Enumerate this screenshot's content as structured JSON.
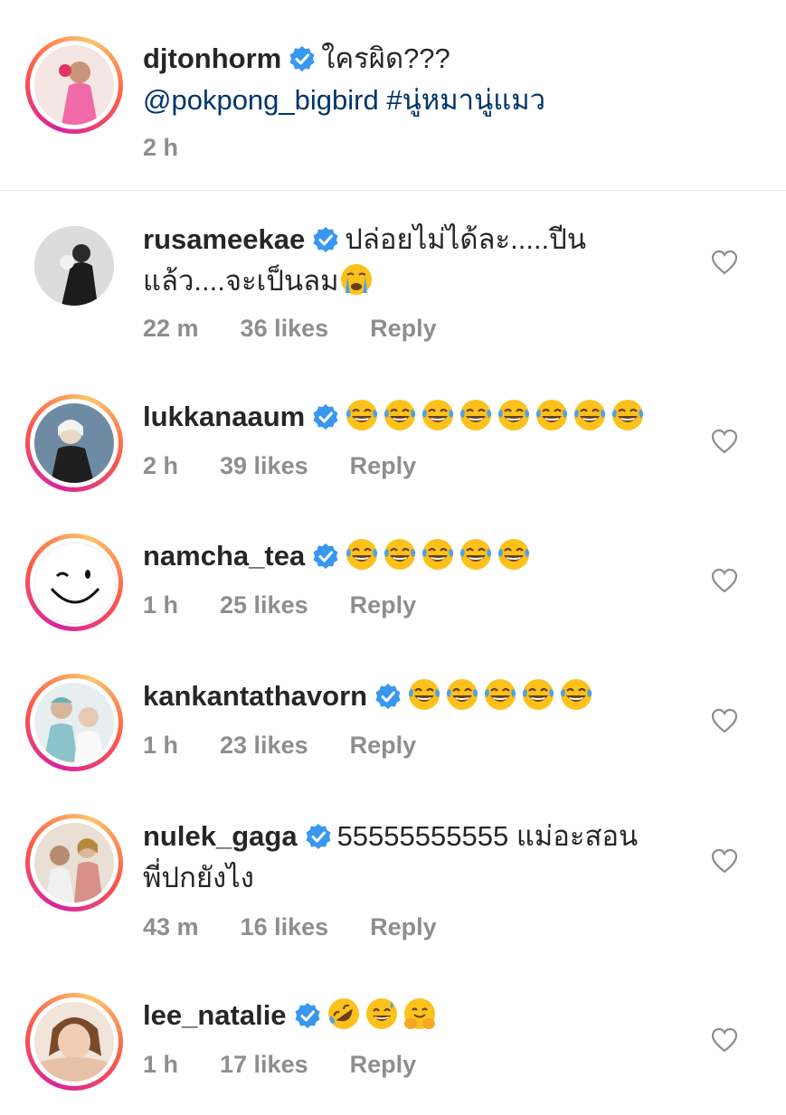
{
  "caption": {
    "username": "djtonhorm",
    "text": "ใครผิด???",
    "mention": "@pokpong_bigbird #นู่หมานู่แมว",
    "time": "2 h"
  },
  "comments": [
    {
      "username": "rusameekae",
      "text": "ปล่อยไม่ได้ละ.....ปีน",
      "text2": "แล้ว....จะเป็นลม",
      "emojis": [
        "crying-face"
      ],
      "time": "22 m",
      "likes": "36 likes",
      "reply": "Reply"
    },
    {
      "username": "lukkanaaum",
      "text": "",
      "emojis": [
        "laughing-tears",
        "laughing-tears",
        "laughing-tears",
        "laughing-tears",
        "laughing-tears",
        "laughing-tears",
        "laughing-tears",
        "laughing-tears"
      ],
      "time": "2 h",
      "likes": "39 likes",
      "reply": "Reply"
    },
    {
      "username": "namcha_tea",
      "text": "",
      "emojis": [
        "laughing-tears",
        "laughing-tears",
        "laughing-tears",
        "laughing-tears",
        "laughing-tears"
      ],
      "time": "1 h",
      "likes": "25 likes",
      "reply": "Reply"
    },
    {
      "username": "kankantathavorn",
      "text": "",
      "emojis": [
        "laughing-tears",
        "laughing-tears",
        "laughing-tears",
        "laughing-tears",
        "laughing-tears"
      ],
      "time": "1 h",
      "likes": "23 likes",
      "reply": "Reply"
    },
    {
      "username": "nulek_gaga",
      "text": "55555555555 แม่อะสอน",
      "text2": "พี่ปกยังไง",
      "emojis": [],
      "time": "43 m",
      "likes": "16 likes",
      "reply": "Reply"
    },
    {
      "username": "lee_natalie",
      "text": "",
      "emojis": [
        "rolling-laughing",
        "sweat-smile",
        "hugging-face"
      ],
      "time": "1 h",
      "likes": "17 likes",
      "reply": "Reply"
    }
  ],
  "colors": {
    "verified": "#3897f0",
    "mention": "#003569",
    "meta": "#8e8e8e"
  }
}
